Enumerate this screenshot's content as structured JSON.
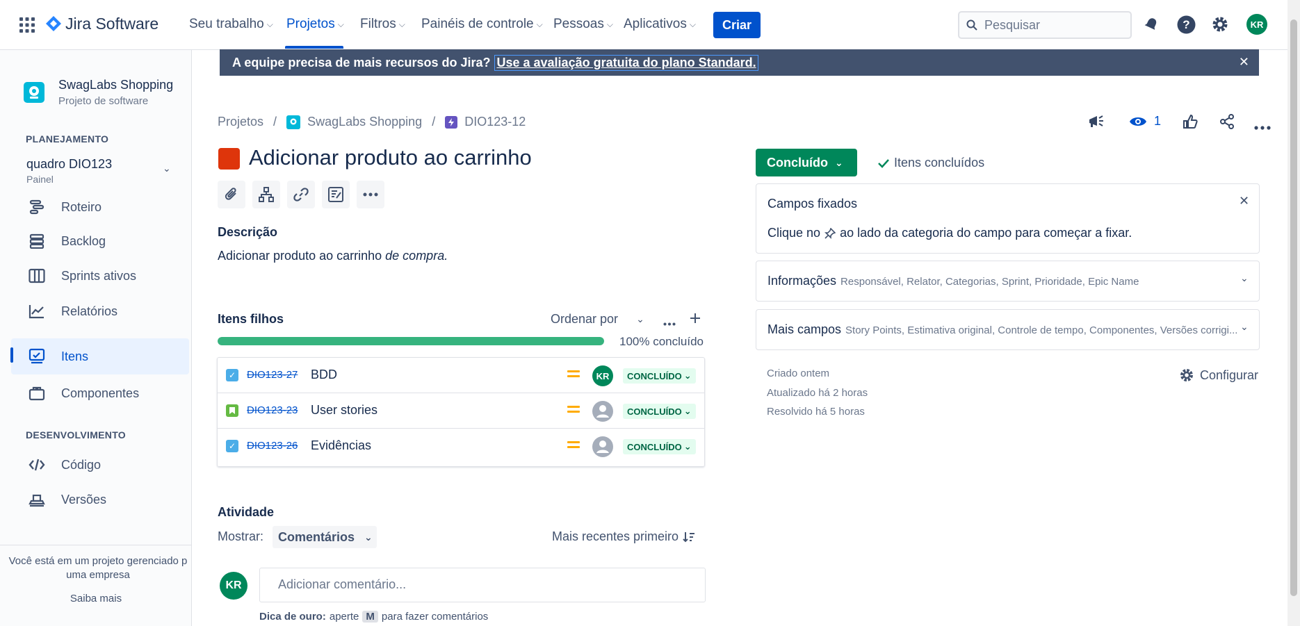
{
  "topnav": {
    "product": "Jira Software",
    "items": [
      {
        "label": "Seu trabalho"
      },
      {
        "label": "Projetos"
      },
      {
        "label": "Filtros"
      },
      {
        "label": "Painéis de controle"
      },
      {
        "label": "Pessoas"
      },
      {
        "label": "Aplicativos"
      }
    ],
    "create_label": "Criar",
    "search_placeholder": "Pesquisar",
    "avatar_initials": "KR"
  },
  "sidebar": {
    "project_name": "SwagLabs Shopping",
    "project_type": "Projeto de software",
    "planning_label": "PLANEJAMENTO",
    "board_name": "quadro DIO123",
    "board_type": "Painel",
    "planning_items": [
      {
        "label": "Roteiro",
        "icon": "roadmap-icon"
      },
      {
        "label": "Backlog",
        "icon": "backlog-icon"
      },
      {
        "label": "Sprints ativos",
        "icon": "sprints-icon"
      },
      {
        "label": "Relatórios",
        "icon": "reports-icon"
      },
      {
        "label": "Itens",
        "icon": "issues-icon"
      },
      {
        "label": "Componentes",
        "icon": "components-icon"
      }
    ],
    "dev_label": "DESENVOLVIMENTO",
    "dev_items": [
      {
        "label": "Código",
        "icon": "code-icon"
      },
      {
        "label": "Versões",
        "icon": "releases-icon"
      }
    ],
    "footer_text": "Você está em um projeto gerenciado p uma empresa",
    "footer_link": "Saiba mais"
  },
  "banner": {
    "text": "A equipe precisa de mais recursos do Jira?",
    "link": "Use a avaliação gratuita do plano Standard."
  },
  "breadcrumbs": {
    "root": "Projetos",
    "project": "SwagLabs Shopping",
    "issue": "DIO123-12"
  },
  "issue": {
    "title": "Adicionar produto ao carrinho",
    "watchers": "1",
    "description_label": "Descrição",
    "description_plain": "Adicionar produto ao carrinho ",
    "description_italic": "de compra."
  },
  "children": {
    "label": "Itens filhos",
    "sort_label": "Ordenar por",
    "progress_percent": 100,
    "progress_text": "100% concluído",
    "rows": [
      {
        "key": "DIO123-27",
        "summary": "BDD",
        "type": "task",
        "assignee": "KR",
        "status": "CONCLUÍDO"
      },
      {
        "key": "DIO123-23",
        "summary": "User stories",
        "type": "story",
        "assignee": "",
        "status": "CONCLUÍDO"
      },
      {
        "key": "DIO123-26",
        "summary": "Evidências",
        "type": "task",
        "assignee": "",
        "status": "CONCLUÍDO"
      }
    ]
  },
  "activity": {
    "label": "Atividade",
    "show_label": "Mostrar:",
    "show_value": "Comentários",
    "order_label": "Mais recentes primeiro",
    "avatar_initials": "KR",
    "comment_placeholder": "Adicionar comentário...",
    "tip_bold": "Dica de ouro:",
    "tip_text_a": "aperte",
    "tip_key": "M",
    "tip_text_b": "para fazer comentários"
  },
  "right": {
    "status_label": "Concluído",
    "resolution_label": "Itens concluídos",
    "pinned_title": "Campos fixados",
    "pinned_text_a": "Clique no",
    "pinned_text_b": "ao lado da categoria do campo para começar a fixar.",
    "info_title": "Informações",
    "info_sub": "Responsável, Relator, Categorias, Sprint, Prioridade, Epic Name",
    "more_title": "Mais campos",
    "more_sub": "Story Points, Estimativa original, Controle de tempo, Componentes, Versões corrigi...",
    "created": "Criado ontem",
    "updated": "Atualizado há 2 horas",
    "resolved": "Resolvido há 5 horas",
    "configure": "Configurar"
  },
  "colors": {
    "brand": "#0052cc",
    "done_green": "#00875a",
    "progress": "#36b37e",
    "banner": "#42526e",
    "issue_type": "#de350b"
  }
}
